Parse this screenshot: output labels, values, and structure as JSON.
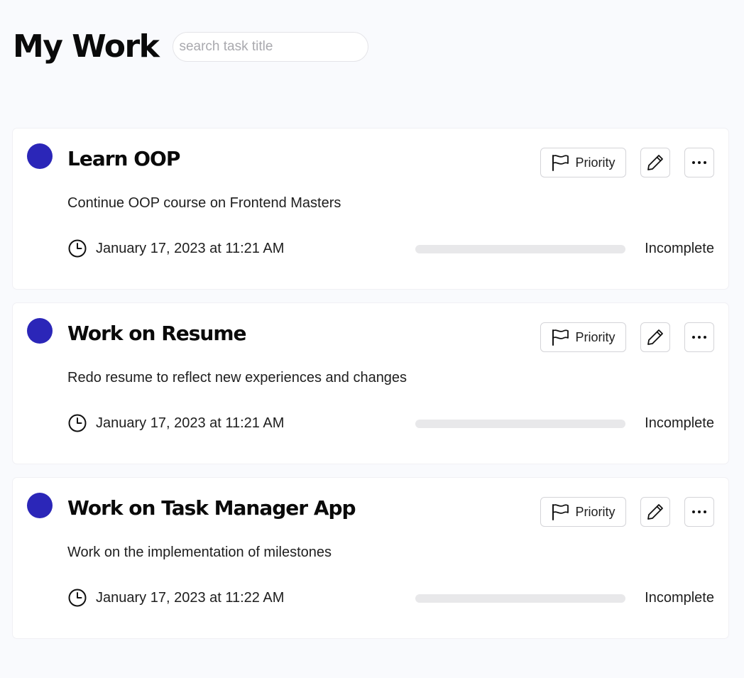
{
  "header": {
    "title": "My Work",
    "search_placeholder": "search task title",
    "search_value": ""
  },
  "colors": {
    "accent": "#2b26b8",
    "background": "#f9fafd",
    "card": "#ffffff",
    "progress_track": "#e8e8ea"
  },
  "icons": {
    "priority": "flag-icon",
    "edit": "pencil-icon",
    "more": "more-horizontal-icon",
    "date": "clock-icon",
    "status": "status-dot-icon"
  },
  "tasks": [
    {
      "title": "Learn OOP",
      "description": "Continue OOP course on Frontend Masters",
      "date": "January 17, 2023 at 11:21 AM",
      "priority_label": "Priority",
      "status": "Incomplete",
      "progress": 0
    },
    {
      "title": "Work on Resume",
      "description": "Redo resume to reflect new experiences and changes",
      "date": "January 17, 2023 at 11:21 AM",
      "priority_label": "Priority",
      "status": "Incomplete",
      "progress": 0
    },
    {
      "title": "Work on Task Manager App",
      "description": "Work on the implementation of milestones",
      "date": "January 17, 2023 at 11:22 AM",
      "priority_label": "Priority",
      "status": "Incomplete",
      "progress": 0
    }
  ]
}
